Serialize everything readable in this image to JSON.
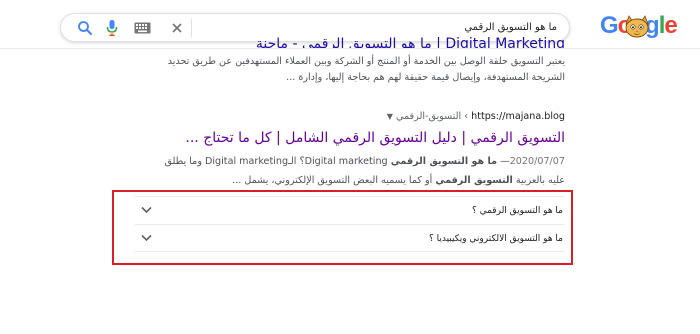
{
  "header": {
    "logo_text": "Google",
    "search_query": "ما هو التسويق الرقمي",
    "icons": [
      "clear-icon",
      "keyboard-icon",
      "mic-icon",
      "search-icon"
    ]
  },
  "previous_result": {
    "title_partial": "Digital Marketing | ما هو التسويق الرقمي - ماجنة",
    "snippet": "يعتبر التسويق حلقة الوصل بين الخدمة أو المنتج أو الشركة وبين العملاء المستهدفين عن طريق تحديد الشريحة المستهدفة، وإيصال قيمة حقيقة لهم هم بحاجة إليها، وإدارة ..."
  },
  "result": {
    "cite_domain": "https://majana.blog",
    "cite_path": "› التسويق-الرقمي",
    "title": "التسويق الرقمي | دليل التسويق الرقمي الشامل | كل ما تحتاج ...",
    "date": "2020/07/07",
    "snippet_line1_prefix": "— ",
    "snippet_bold1": "ما هو التسويق الرقمي",
    "snippet_text1": " Digital marketing؟ الـDigital marketing وما يطلق",
    "snippet_line2_a": "عليه بالعربية ",
    "snippet_bold2": "التسويق الرقمي",
    "snippet_line2_b": " أو كما يسميه البعض التسويق الإلكتروني، يشمل ..."
  },
  "questions": [
    {
      "text": "ما هو التسويق الرقمي ؟"
    },
    {
      "text": "ما هو التسويق الالكتروني ويكيبيديا ؟"
    }
  ],
  "colors": {
    "highlight": "#d91e27",
    "visited_link": "#660099",
    "link": "#1a0dab"
  }
}
